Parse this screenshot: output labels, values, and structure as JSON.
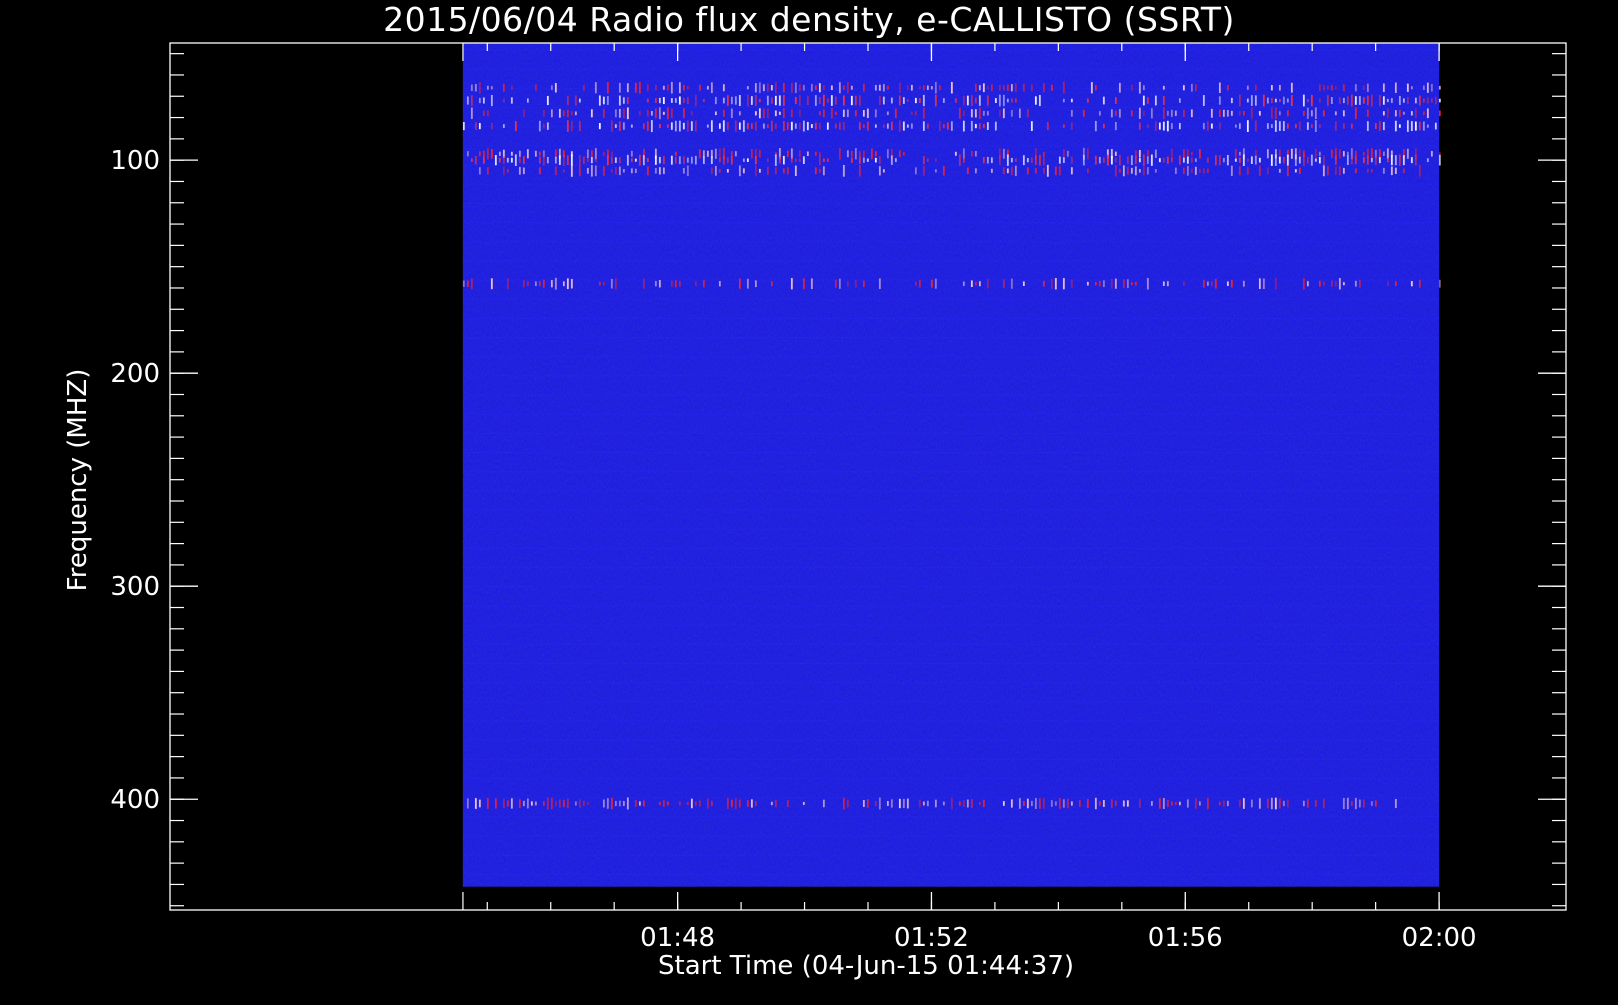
{
  "chart_data": {
    "type": "heatmap",
    "title": "2015/06/04  Radio flux density, e-CALLISTO (SSRT)",
    "xlabel": "Start Time (04-Jun-15 01:44:37)",
    "ylabel": "Frequency (MHZ)",
    "x_start_seconds": 6277,
    "x_end_seconds": 7200,
    "xlim_seconds": [
      6000,
      7320
    ],
    "x_major_ticks": [
      {
        "seconds": 6480,
        "label": "01:48"
      },
      {
        "seconds": 6720,
        "label": "01:52"
      },
      {
        "seconds": 6960,
        "label": "01:56"
      },
      {
        "seconds": 7200,
        "label": "02:00"
      }
    ],
    "x_minor_step_seconds": 60,
    "ylim": [
      45,
      452
    ],
    "y_inverted": true,
    "y_data_range": [
      45,
      441
    ],
    "y_major_ticks": [
      {
        "value": 100,
        "label": "100"
      },
      {
        "value": 200,
        "label": "200"
      },
      {
        "value": 300,
        "label": "300"
      },
      {
        "value": 400,
        "label": "400"
      }
    ],
    "y_minor_step": 10,
    "background_color": "#1818e8",
    "interference_bands": [
      {
        "freq_mhz": 66,
        "intensity": 0.55,
        "color": "#ff2020"
      },
      {
        "freq_mhz": 72,
        "intensity": 0.7,
        "color": "#ffffff"
      },
      {
        "freq_mhz": 78,
        "intensity": 0.55,
        "color": "#ff2020"
      },
      {
        "freq_mhz": 84,
        "intensity": 0.65,
        "color": "#ffffff"
      },
      {
        "freq_mhz": 97,
        "intensity": 0.6,
        "color": "#ff2020"
      },
      {
        "freq_mhz": 100,
        "intensity": 0.8,
        "color": "#ffffff"
      },
      {
        "freq_mhz": 105,
        "intensity": 0.5,
        "color": "#ff2020"
      },
      {
        "freq_mhz": 158,
        "intensity": 0.45,
        "color": "#ff2020"
      },
      {
        "freq_mhz": 402,
        "intensity": 0.7,
        "color": "#ff2020"
      }
    ]
  }
}
